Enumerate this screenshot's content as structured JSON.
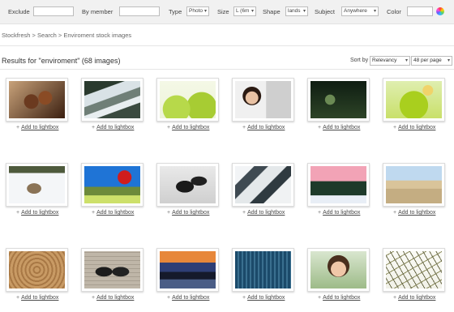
{
  "filters": {
    "exclude_label": "Exclude",
    "member_label": "By member",
    "type_label": "Type",
    "type_value": "Photo",
    "size_label": "Size",
    "size_value": "L (6m",
    "shape_label": "Shape",
    "shape_value": "lands",
    "subject_label": "Subject",
    "subject_value": "Anywhere",
    "color_label": "Color"
  },
  "breadcrumb": [
    "Stockfresh",
    "Search",
    "Enviroment stock images"
  ],
  "breadcrumb_sep": ">",
  "results_title": "Results for \"enviroment\" (68 images)",
  "sort": {
    "label": "Sort by",
    "value": "Relevancy",
    "per_page": "48 per page"
  },
  "add_label": "Add to lightbox",
  "add_plus": "+",
  "images": [
    "coffee-beans-icon",
    "waterfall-icon",
    "green-ornament-icon",
    "woman-phone-icon",
    "dark-forest-icon",
    "green-ornament-bow-icon",
    "reindeer-snow-icon",
    "stop-sign-icon",
    "snow-stream-icon",
    "icy-river-icon",
    "snowy-pines-icon",
    "dunes-icon",
    "wood-rings-icon",
    "two-women-icon",
    "sunset-road-icon",
    "stadium-seats-icon",
    "smiling-woman-icon",
    "sketch-lines-icon"
  ]
}
